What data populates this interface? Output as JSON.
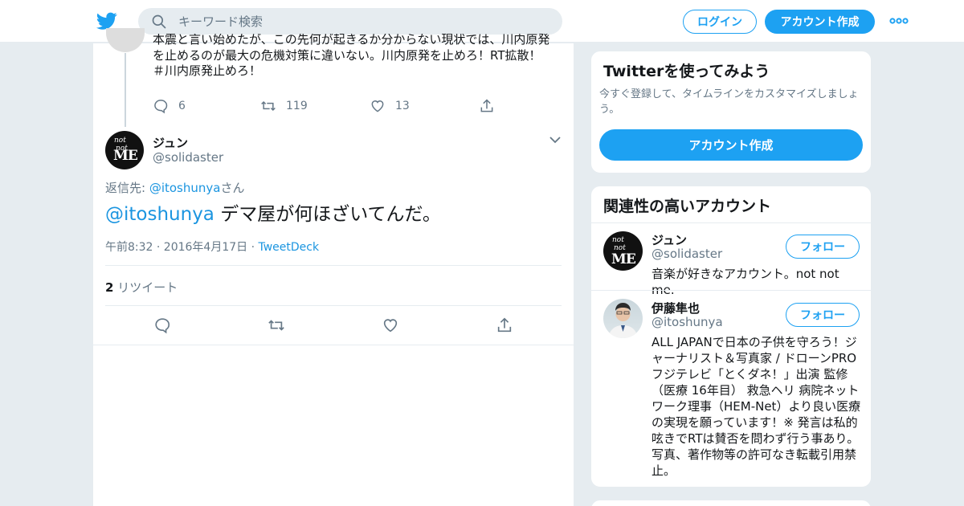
{
  "header": {
    "search_placeholder": "キーワード検索",
    "login_label": "ログイン",
    "signup_label": "アカウント作成"
  },
  "prev_tweet": {
    "text_line1": "本震と言い始めたが、この先何が起きるか分からない現状では、川内原発",
    "text_line2": "を止めるのが最大の危機対策に違いない。川内原発を止めろ！RT拡散！",
    "text_line3": "＃川内原発止めろ！",
    "replies": "6",
    "retweets": "119",
    "likes": "13"
  },
  "tweet": {
    "name": "ジュン",
    "handle": "@solidaster",
    "reply_prefix": "返信先: ",
    "reply_handle": "@itoshunya",
    "reply_suffix": "さん",
    "mention": "@itoshunya",
    "text": " デマ屋が何ほざいてんだ。",
    "time": "午前8:32 · 2016年4月17日 · ",
    "client": "TweetDeck",
    "rt_count": "2",
    "rt_label": " リツイート"
  },
  "sidebar": {
    "signup_card": {
      "title": "Twitterを使ってみよう",
      "subtitle": "今すぐ登録して、タイムラインをカスタマイズしましょう。",
      "button": "アカウント作成"
    },
    "related": {
      "title": "関連性の高いアカウント",
      "follow_label": "フォロー",
      "accounts": [
        {
          "name": "ジュン",
          "handle": "@solidaster",
          "bio": "音楽が好きなアカウント。not not me."
        },
        {
          "name": "伊藤隼也",
          "handle": "@itoshunya",
          "bio": "ALL JAPANで日本の子供を守ろう！ジャーナリスト＆写真家 / ドローンPRO フジテレビ「とくダネ！」出演 監修（医療 16年目） 救急ヘリ 病院ネットワーク理事（HEM-Net）より良い医療の実現を願っています！※ 発言は私的呟きでRTは賛否を問わず行う事あり。写真、著作物等の許可なき転載引用禁止。"
        }
      ]
    }
  },
  "avatar_text": {
    "a": "not",
    "b": "not",
    "c": "ME"
  },
  "colors": {
    "accent": "#1da1f2",
    "link": "#1b95e0",
    "muted": "#657786"
  }
}
